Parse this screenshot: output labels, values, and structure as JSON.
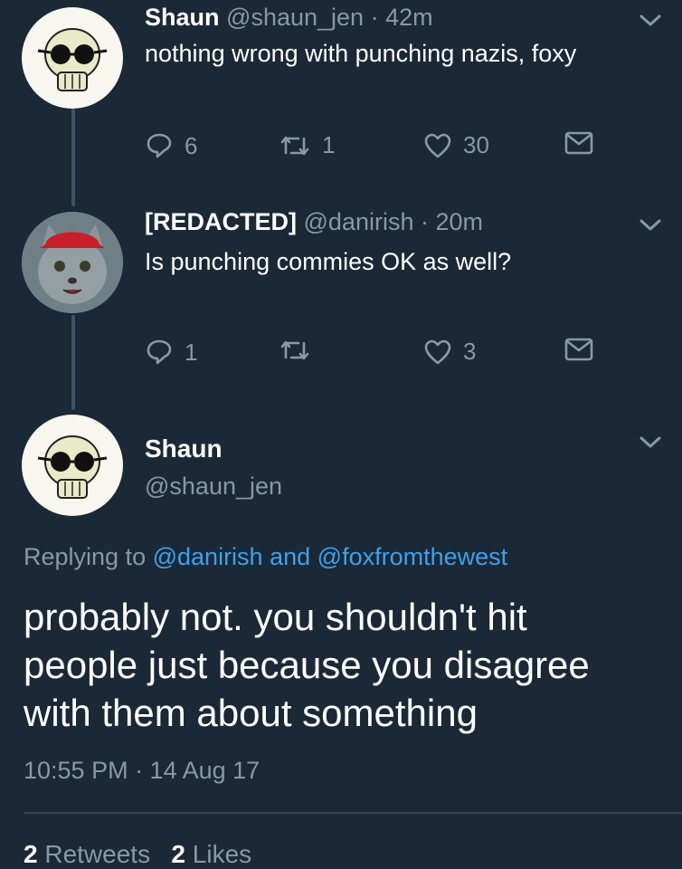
{
  "colors": {
    "background": "#1b2836",
    "secondary_text": "#8899a6",
    "link": "#3ea1ec",
    "thread_line": "#3d5466"
  },
  "tweet1": {
    "name": "Shaun",
    "handle": "@shaun_jen",
    "separator": "·",
    "time": "42m",
    "text": "nothing wrong with punching nazis, foxy",
    "replies": "6",
    "retweets": "1",
    "likes": "30",
    "avatar_icon": "skull-sunglasses-avatar"
  },
  "tweet2": {
    "name": "[REDACTED]",
    "handle": "@danirish",
    "separator": "·",
    "time": "20m",
    "text": "Is punching commies OK as well?",
    "replies": "1",
    "retweets": "",
    "likes": "3",
    "avatar_icon": "cat-red-cap-avatar"
  },
  "main_tweet": {
    "name": "Shaun",
    "handle": "@shaun_jen",
    "replying_prefix": "Replying to",
    "reply_to_1": "@danirish",
    "reply_and": "and",
    "reply_to_2": "@foxfromthewest",
    "text_line1": "probably not. you shouldn't hit",
    "text_line2": "people just because you disagree",
    "text_line3": "with them about something",
    "timestamp": "10:55 PM · 14 Aug 17",
    "retweet_count": "2",
    "retweet_label": "Retweets",
    "like_count": "2",
    "like_label": "Likes"
  }
}
